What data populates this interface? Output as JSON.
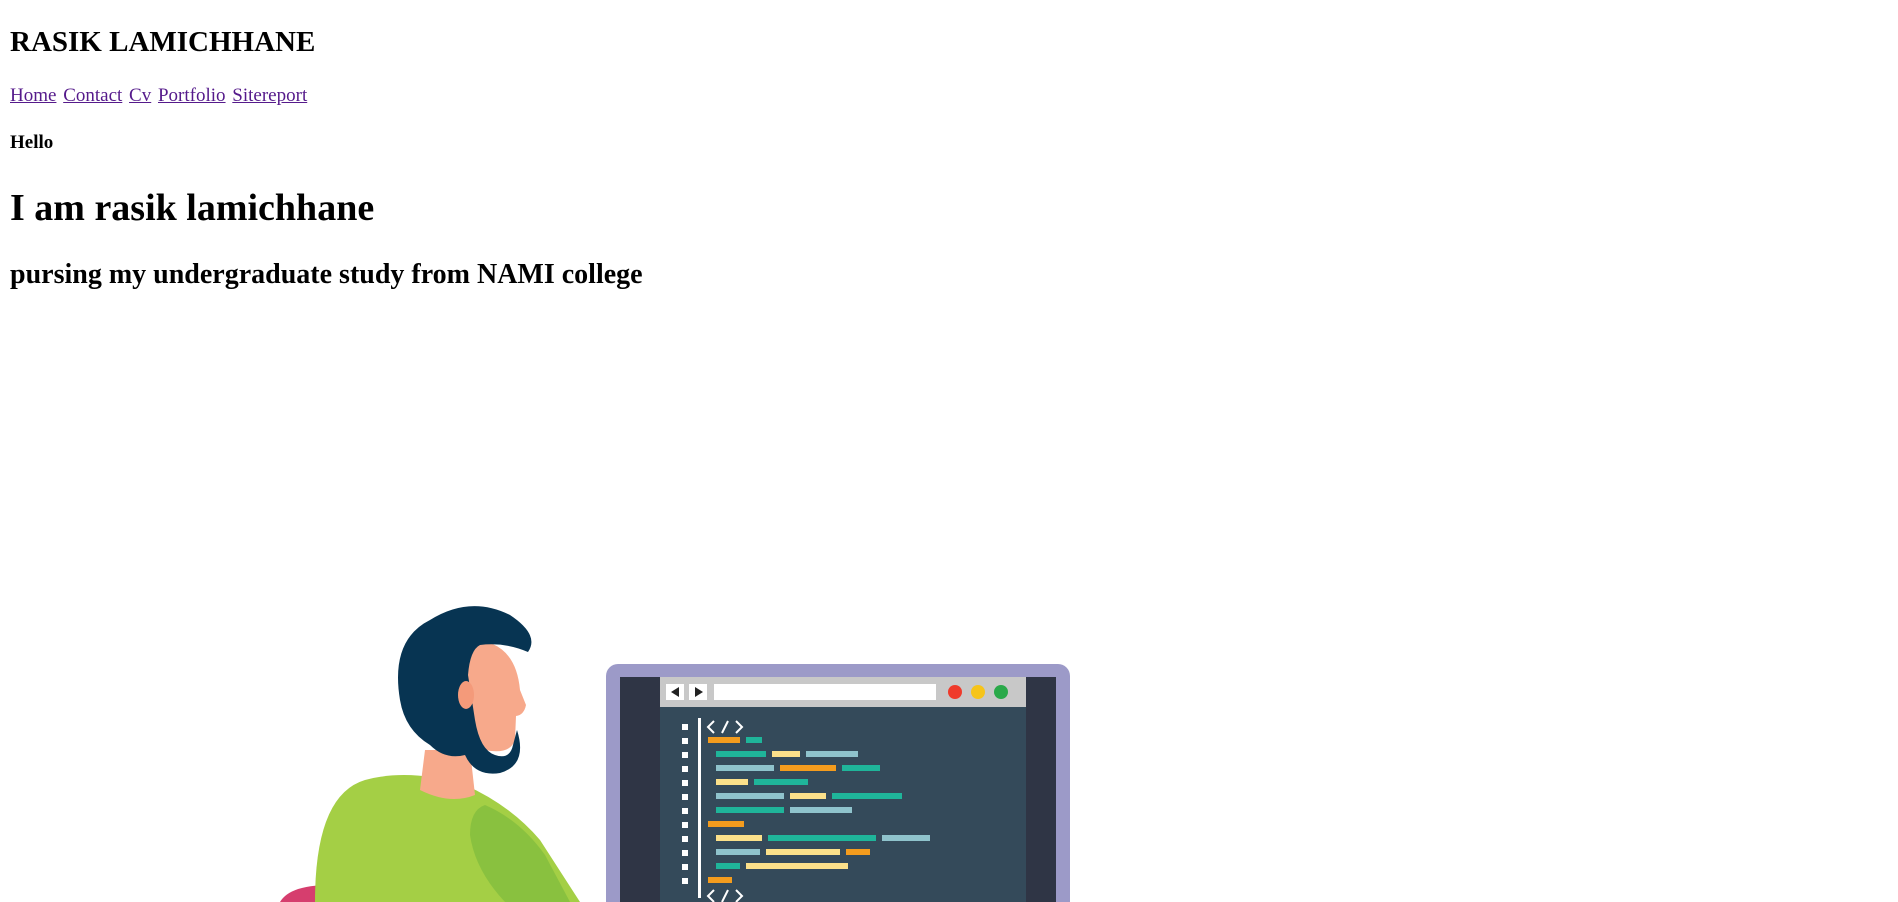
{
  "header": {
    "title": "RASIK LAMICHHANE"
  },
  "nav": {
    "items": [
      {
        "label": "Home"
      },
      {
        "label": "Contact"
      },
      {
        "label": "Cv"
      },
      {
        "label": "Portfolio"
      },
      {
        "label": "Sitereport"
      }
    ]
  },
  "main": {
    "greeting": "Hello",
    "heading": "I am rasik lamichhane",
    "subheading": "pursing my undergraduate study from NAMI college"
  },
  "illustration": {
    "icon": "developer-at-computer-illustration",
    "colors": {
      "hair": "#073452",
      "skin": "#f7a98b",
      "shirt": "#a4cf45",
      "monitor_frame": "#9c9ac8",
      "screen": "#344a5a",
      "red": "#ef3a2b",
      "yellow": "#f6c41a",
      "green": "#2aa94a"
    }
  }
}
